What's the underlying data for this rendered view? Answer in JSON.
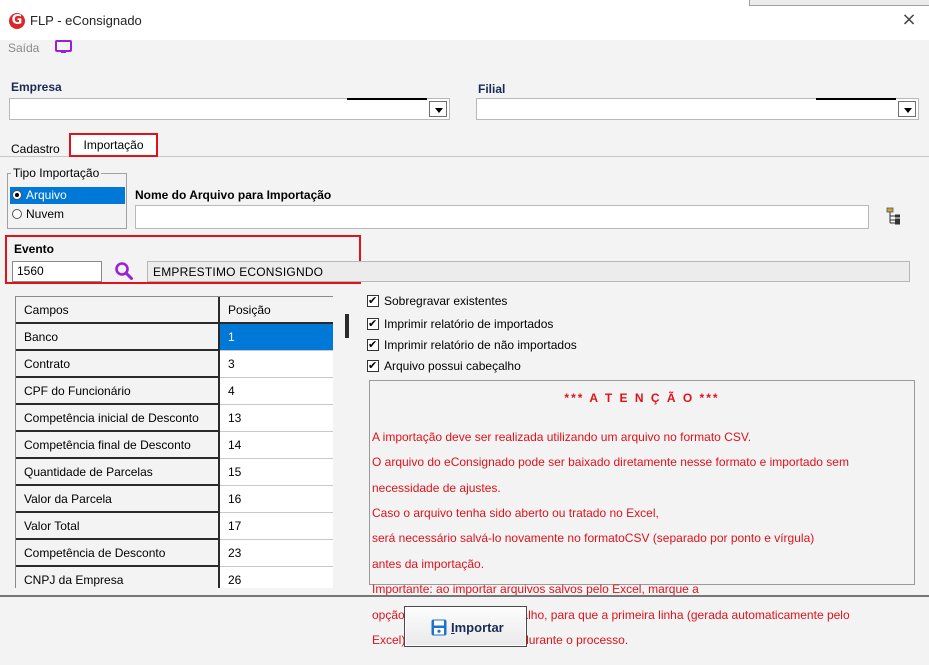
{
  "window": {
    "title": "FLP - eConsignado",
    "logo_letter": "G",
    "close_glyph": "×",
    "accent_color": "#e0121b",
    "selection_color": "#0078d7"
  },
  "menu": {
    "saida_label": "Saída",
    "saida_icon": "monitor-icon"
  },
  "empresa": {
    "label": "Empresa",
    "value": ""
  },
  "filial": {
    "label": "Filial",
    "value": ""
  },
  "tabs": [
    {
      "label": "Cadastro",
      "active": false
    },
    {
      "label": "Importação",
      "active": true
    }
  ],
  "tipo_importacao": {
    "title": "Tipo Importação",
    "options": [
      {
        "label": "Arquivo",
        "selected": true
      },
      {
        "label": "Nuvem",
        "selected": false
      }
    ]
  },
  "arquivo": {
    "label": "Nome do Arquivo para Importação",
    "value": "",
    "browse_icon": "file-tree-icon"
  },
  "evento": {
    "label": "Evento",
    "code": "1560",
    "description": "EMPRESTIMO ECONSIGNDO",
    "search_icon": "search-icon"
  },
  "table": {
    "headers": [
      "Campos",
      "Posição"
    ],
    "rows": [
      {
        "campo": "Banco",
        "posicao": "1",
        "selected": true
      },
      {
        "campo": "Contrato",
        "posicao": "3"
      },
      {
        "campo": "CPF do Funcionário",
        "posicao": "4"
      },
      {
        "campo": "Competência inicial de Desconto",
        "posicao": "13"
      },
      {
        "campo": "Competência final de Desconto",
        "posicao": "14"
      },
      {
        "campo": "Quantidade de Parcelas",
        "posicao": "15"
      },
      {
        "campo": "Valor da Parcela",
        "posicao": "16"
      },
      {
        "campo": "Valor Total",
        "posicao": "17"
      },
      {
        "campo": "Competência de Desconto",
        "posicao": "23"
      },
      {
        "campo": "CNPJ da Empresa",
        "posicao": "26"
      }
    ]
  },
  "options": [
    {
      "label": "Sobregravar existentes",
      "checked": true
    },
    {
      "label": "Imprimir relatório de importados",
      "checked": true
    },
    {
      "label": "Imprimir relatório de não importados",
      "checked": true
    },
    {
      "label": "Arquivo possui cabeçalho",
      "checked": true
    }
  ],
  "notice": {
    "title": "*** A T E N Ç Ã O ***",
    "lines": [
      "A importação deve ser realizada utilizando um arquivo no formato CSV.",
      "O arquivo do eConsignado pode ser baixado diretamente nesse formato e importado sem",
      "necessidade de ajustes.",
      "Caso o arquivo tenha sido aberto ou tratado no Excel,",
      "será necessário salvá-lo novamente no formatoCSV (separado por ponto e vírgula)",
      "antes da importação.",
      "Importante: ao importar arquivos salvos pelo Excel, marque a",
      "opção Arquivo possui cabeçalho, para que a primeira linha (gerada automaticamente pelo",
      "Excel) seja desconsiderada durante o processo."
    ]
  },
  "actions": {
    "import_label": "Importar",
    "import_icon": "save-icon"
  }
}
